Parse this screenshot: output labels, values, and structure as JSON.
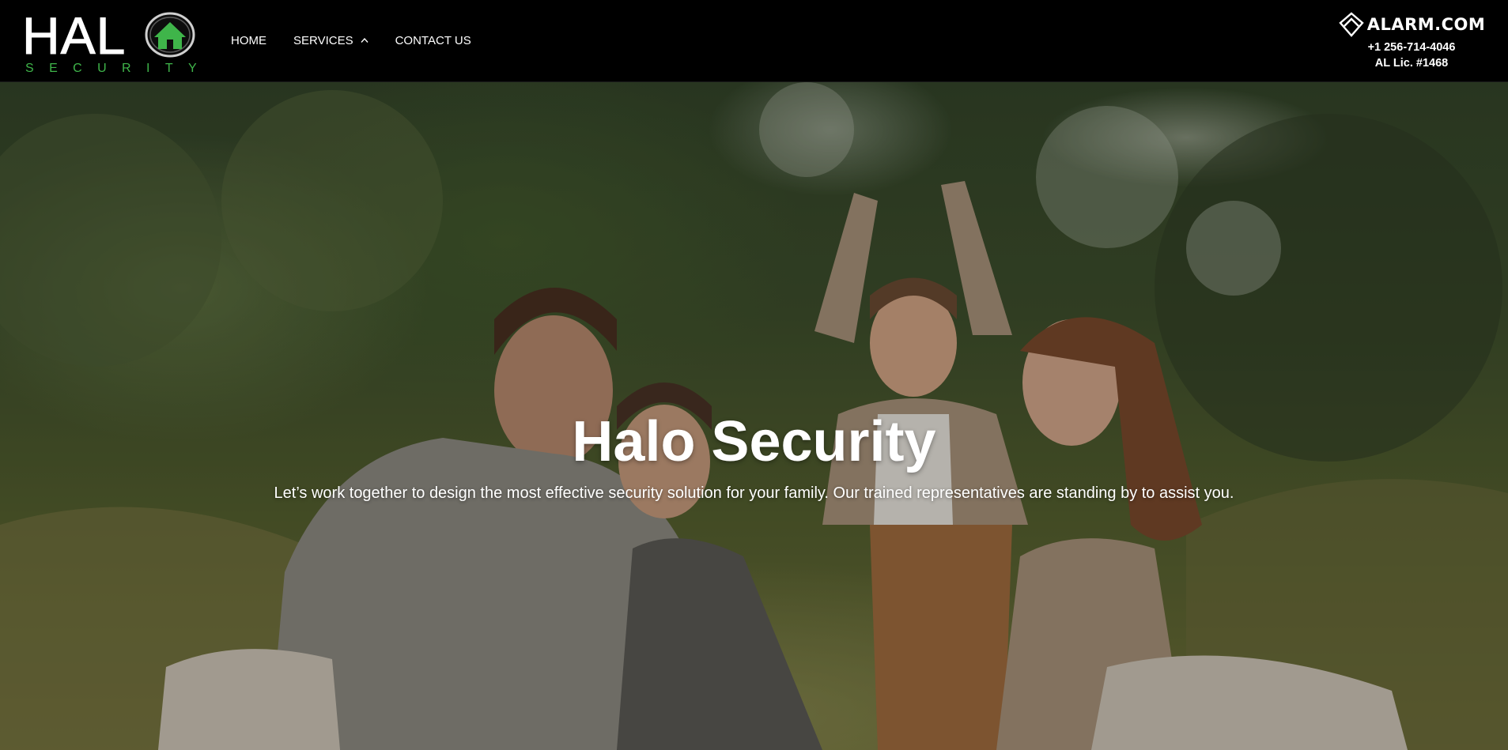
{
  "brand": {
    "name": "HAL",
    "tagline": "SECURITY",
    "accent_color": "#3fb54a",
    "icon": "house-globe-icon"
  },
  "nav": {
    "items": [
      {
        "label": "HOME"
      },
      {
        "label": "SERVICES",
        "icon": "chevron-up-icon"
      },
      {
        "label": "CONTACT US"
      }
    ]
  },
  "partner": {
    "name": "ALARM.COM",
    "icon": "alarm-com-logo-icon",
    "phone": "+1 256-714-4046",
    "license": "AL Lic. #1468"
  },
  "hero": {
    "title": "Halo Security",
    "subtitle": "Let’s work together to design the most effective security solution for your family. Our trained representatives are standing by to assist you."
  }
}
